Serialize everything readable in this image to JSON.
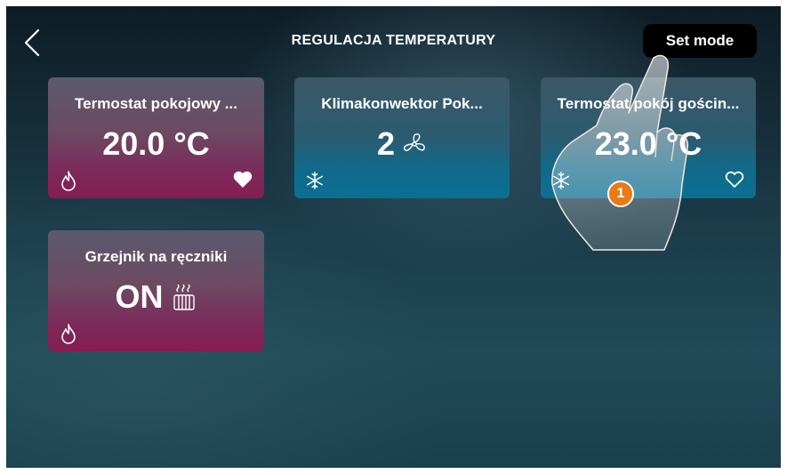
{
  "header": {
    "title": "REGULACJA TEMPERATURY",
    "set_mode_label": "Set mode",
    "back_icon": "chevron-left-icon"
  },
  "cards": [
    {
      "name": "Termostat pokojowy ...",
      "value": "20.0 °C",
      "mode": "heating",
      "mode_icon": "flame-icon",
      "favorite": true
    },
    {
      "name": "Klimakonwektor Pok...",
      "value": "2",
      "value_icon": "fan-icon",
      "mode": "cooling",
      "mode_icon": "snowflake-icon"
    },
    {
      "name": "Termostat pokój gościn...",
      "value": "23.0 °C",
      "mode": "cooling",
      "mode_icon": "snowflake-icon",
      "favorite": false
    },
    {
      "name": "Grzejnik na ręczniki",
      "value": "ON",
      "value_icon": "towel-radiator-icon",
      "mode": "heating",
      "mode_icon": "flame-icon"
    }
  ],
  "annotation": {
    "step": "1"
  },
  "colors": {
    "heating_card": "#861c52",
    "cooling_card": "#0b6f92",
    "step_badge": "#e97a14",
    "set_mode_bg": "#000000"
  }
}
